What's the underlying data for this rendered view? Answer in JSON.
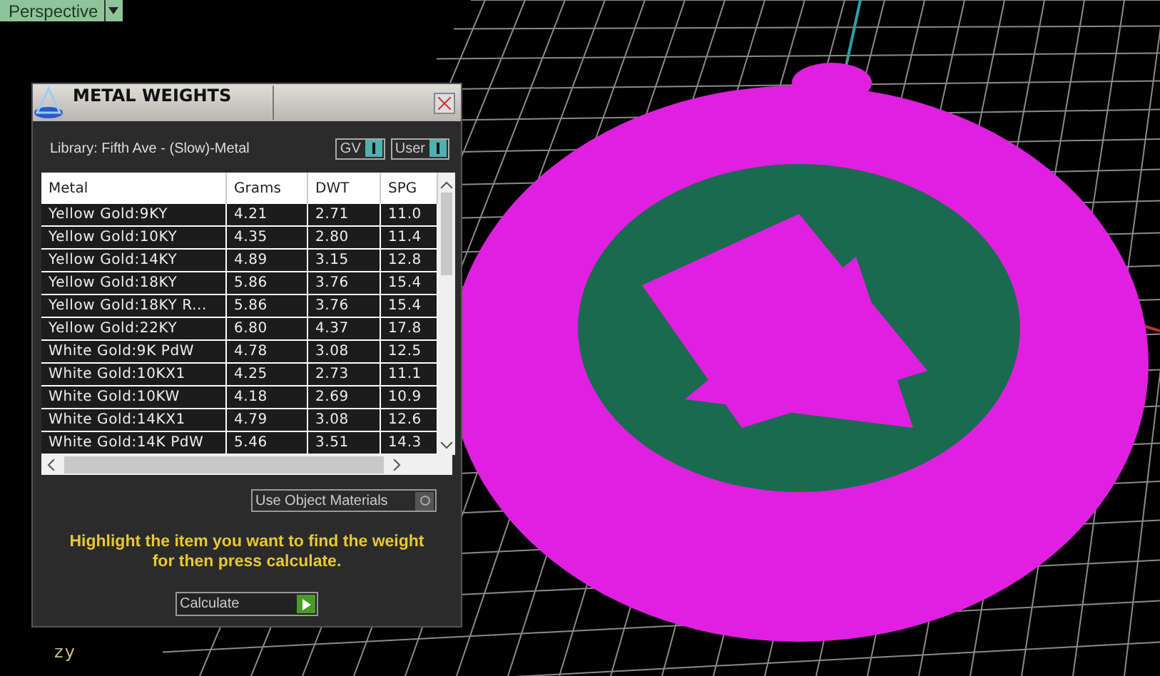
{
  "viewport": {
    "label": "Perspective",
    "axes": [
      "z",
      "y"
    ]
  },
  "panel": {
    "title": "METAL WEIGHTS",
    "library": "Library: Fifth Ave - (Slow)-Metal",
    "toggles": [
      "GV",
      "User"
    ],
    "table": {
      "columns": [
        "Metal",
        "Grams",
        "DWT",
        "SPG"
      ],
      "rows": [
        [
          "Yellow Gold:9KY",
          "4.21",
          "2.71",
          "11.0"
        ],
        [
          "Yellow Gold:10KY",
          "4.35",
          "2.80",
          "11.4"
        ],
        [
          "Yellow Gold:14KY",
          "4.89",
          "3.15",
          "12.8"
        ],
        [
          "Yellow Gold:18KY",
          "5.86",
          "3.76",
          "15.4"
        ],
        [
          "Yellow Gold:18KY R...",
          "5.86",
          "3.76",
          "15.4"
        ],
        [
          "Yellow Gold:22KY",
          "6.80",
          "4.37",
          "17.8"
        ],
        [
          "White Gold:9K PdW",
          "4.78",
          "3.08",
          "12.5"
        ],
        [
          "White Gold:10KX1",
          "4.25",
          "2.73",
          "11.1"
        ],
        [
          "White Gold:10KW",
          "4.18",
          "2.69",
          "10.9"
        ],
        [
          "White Gold:14KX1",
          "4.79",
          "3.08",
          "12.6"
        ],
        [
          "White Gold:14K PdW",
          "5.46",
          "3.51",
          "14.3"
        ]
      ]
    },
    "option": "Use Object Materials",
    "hint": "Highlight the item you want to find the weight for then press calculate.",
    "action": "Calculate"
  }
}
